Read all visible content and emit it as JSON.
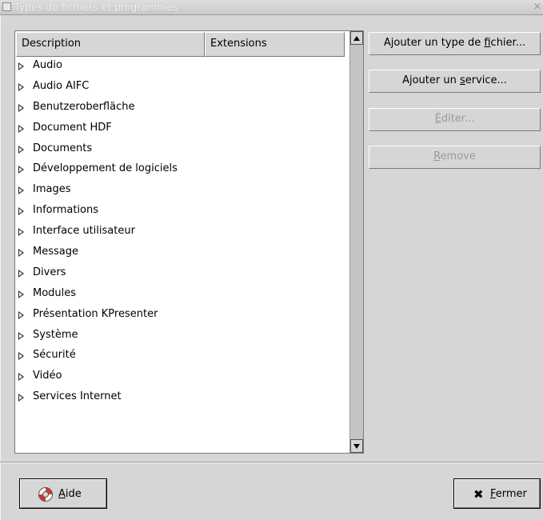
{
  "window": {
    "title": "Types de fichiers et programmes",
    "close_glyph": "✕"
  },
  "list": {
    "columns": [
      "Description",
      "Extensions"
    ],
    "items": [
      {
        "label": "Audio"
      },
      {
        "label": "Audio AIFC"
      },
      {
        "label": "Benutzeroberfläche"
      },
      {
        "label": "Document HDF"
      },
      {
        "label": "Documents"
      },
      {
        "label": "Développement de logiciels"
      },
      {
        "label": "Images"
      },
      {
        "label": "Informations"
      },
      {
        "label": "Interface utilisateur"
      },
      {
        "label": "Message"
      },
      {
        "label": "Divers"
      },
      {
        "label": "Modules"
      },
      {
        "label": "Présentation KPresenter"
      },
      {
        "label": "Système"
      },
      {
        "label": "Sécurité"
      },
      {
        "label": "Vidéo"
      },
      {
        "label": "Services Internet"
      }
    ]
  },
  "side_buttons": {
    "add_type": {
      "pre": "Ajouter un type de ",
      "key": "f",
      "post": "ichier...",
      "enabled": true
    },
    "add_service": {
      "pre": "Ajouter un ",
      "key": "s",
      "post": "ervice...",
      "enabled": true
    },
    "edit": {
      "pre": "",
      "key": "É",
      "post": "diter...",
      "enabled": false
    },
    "remove": {
      "pre": "",
      "key": "R",
      "post": "emove",
      "enabled": false
    }
  },
  "bottom": {
    "help": {
      "key": "A",
      "post": "ide",
      "icon": "lifebuoy-icon"
    },
    "close": {
      "key": "F",
      "post": "ermer",
      "icon": "x-icon",
      "icon_glyph": "✖"
    }
  },
  "colors": {
    "background": "#d6d6d6",
    "list_background": "#ffffff",
    "disabled_text": "#9a9a9a"
  }
}
